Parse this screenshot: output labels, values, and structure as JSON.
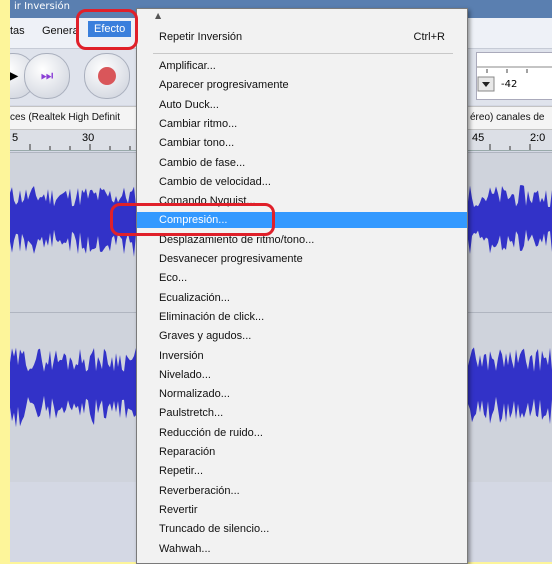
{
  "window": {
    "title": "ir Inversión"
  },
  "menubar": {
    "items": [
      {
        "label": "tas"
      },
      {
        "label": "Genera"
      },
      {
        "label": "Efecto"
      }
    ]
  },
  "device_bar": {
    "left_text": "ces (Realtek High Definit",
    "right_text": "éreo) canales de s"
  },
  "ruler": {
    "left_ticks": [
      "5",
      "30"
    ],
    "right_ticks": [
      "45",
      "2:0"
    ]
  },
  "meter": {
    "db_label": "-42"
  },
  "effect_menu": {
    "top_item": {
      "label": "Repetir Inversión",
      "shortcut": "Ctrl+R"
    },
    "items": [
      "Amplificar...",
      "Aparecer progresivamente",
      "Auto Duck...",
      "Cambiar ritmo...",
      "Cambiar tono...",
      "Cambio de fase...",
      "Cambio de velocidad...",
      "Comando Nyquist...",
      "Compresión...",
      "Desplazamiento de ritmo/tono...",
      "Desvanecer progresivamente",
      "Eco...",
      "Ecualización...",
      "Eliminación de click...",
      "Graves y agudos...",
      "Inversión",
      "Nivelado...",
      "Normalizado...",
      "Paulstretch...",
      "Reducción de ruido...",
      "Reparación",
      "Repetir...",
      "Reverberación...",
      "Revertir",
      "Truncado de silencio...",
      "Wahwah..."
    ],
    "selected_index": 8
  },
  "colors": {
    "frame_background": "#fdf59a",
    "highlight_red": "#e0202a",
    "selection_blue": "#3399ff",
    "waveform_blue": "#3232c8"
  }
}
